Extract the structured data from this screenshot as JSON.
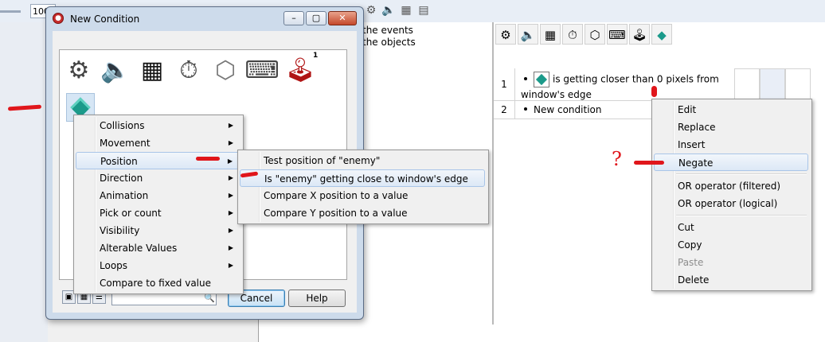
{
  "app": {
    "zoom_value": "100",
    "header_lines": [
      "the events",
      "the objects"
    ]
  },
  "dialog": {
    "title": "New Condition",
    "window_buttons": {
      "minimize": "–",
      "maximize": "▢",
      "close": "✕"
    },
    "category_icons": [
      "gear-icon",
      "speaker-icon",
      "chessboard-icon",
      "timer-icon",
      "box-icon",
      "keyboard-mouse-icon",
      "joystick-icon"
    ],
    "joystick_badge": "1",
    "buttons": {
      "cancel": "Cancel",
      "help": "Help"
    },
    "search": {
      "value": ""
    }
  },
  "object_menu": {
    "items": [
      {
        "label": "Collisions",
        "submenu": true
      },
      {
        "label": "Movement",
        "submenu": true
      },
      {
        "label": "Position",
        "submenu": true,
        "selected": true
      },
      {
        "label": "Direction",
        "submenu": true
      },
      {
        "label": "Animation",
        "submenu": true
      },
      {
        "label": "Pick or count",
        "submenu": true
      },
      {
        "label": "Visibility",
        "submenu": true
      },
      {
        "label": "Alterable Values",
        "submenu": true
      },
      {
        "label": "Loops",
        "submenu": true
      },
      {
        "label": "Compare to fixed value",
        "submenu": false
      }
    ]
  },
  "position_submenu": {
    "items": [
      {
        "label": "Test position of \"enemy\""
      },
      {
        "label": "Is \"enemy\" getting close to window's edge",
        "selected": true
      },
      {
        "label": "Compare X position to a value"
      },
      {
        "label": "Compare Y position to a value"
      }
    ]
  },
  "events": {
    "rows": [
      {
        "number": "1",
        "text_line1": "is getting closer than 0 pixels from",
        "text_line2": "window's edge"
      },
      {
        "number": "2",
        "text_line1": "New condition",
        "text_line2": ""
      }
    ]
  },
  "context_menu": {
    "groups": [
      [
        "Edit",
        "Replace",
        "Insert",
        "Negate"
      ],
      [
        "OR operator (filtered)",
        "OR operator (logical)"
      ],
      [
        "Cut",
        "Copy",
        "Paste",
        "Delete"
      ]
    ],
    "selected": "Negate",
    "disabled": [
      "Paste"
    ]
  },
  "annotation": {
    "question_mark": "?"
  }
}
